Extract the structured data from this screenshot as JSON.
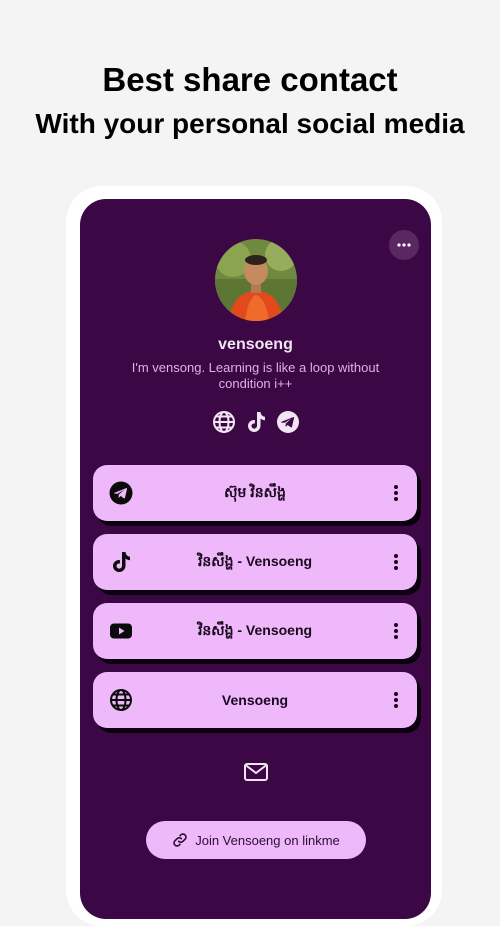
{
  "headline": {
    "line1": "Best share contact",
    "line2": "With your personal social media"
  },
  "profile": {
    "username": "vensoeng",
    "bio": "I'm vensong. Learning is like a loop without condition i++"
  },
  "social_icons": [
    "globe-icon",
    "tiktok-icon",
    "telegram-icon"
  ],
  "links": [
    {
      "icon": "telegram-icon",
      "label": "ស៊ុម វិនសឹង្ហ"
    },
    {
      "icon": "tiktok-icon",
      "label": "វិនសឹង្ហ - Vensoeng"
    },
    {
      "icon": "youtube-icon",
      "label": "វិនសឹង្ហ - Vensoeng"
    },
    {
      "icon": "globe-icon",
      "label": "Vensoeng"
    }
  ],
  "footer": {
    "join_label": "Join Vensoeng on linkme"
  },
  "colors": {
    "background": "#f4f4f4",
    "screen": "#3b0744",
    "card": "#efb8fb",
    "bio_text": "#dcb2e8"
  }
}
